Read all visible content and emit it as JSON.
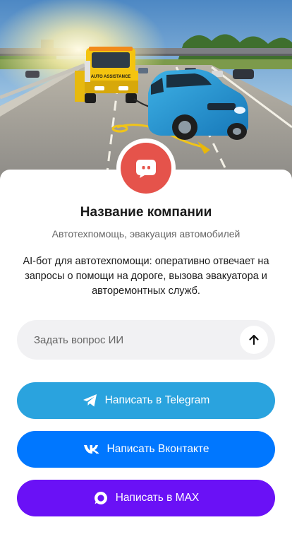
{
  "company": {
    "name": "Название компании",
    "category": "Автотехпомощь, эвакуация автомобилей",
    "description": "AI-бот для автотехпомощи: оперативно отвечает на запросы о помощи на дороге, вызова эвакуатора и авторемонтных служб."
  },
  "hero": {
    "truck_sign": "AUTO ASSISTANCE"
  },
  "ask": {
    "placeholder": "Задать вопрос ИИ"
  },
  "buttons": {
    "telegram": "Написать в Telegram",
    "vk": "Написать Вконтакте",
    "max": "Написать в MAX"
  },
  "icons": {
    "avatar": "chat-bubble-icon",
    "send": "arrow-up-icon",
    "telegram": "telegram-icon",
    "vk": "vk-icon",
    "max": "max-icon"
  },
  "colors": {
    "avatar": "#e5534b",
    "telegram": "#2aa3de",
    "vk": "#0077ff",
    "max": "#6a11f6"
  }
}
